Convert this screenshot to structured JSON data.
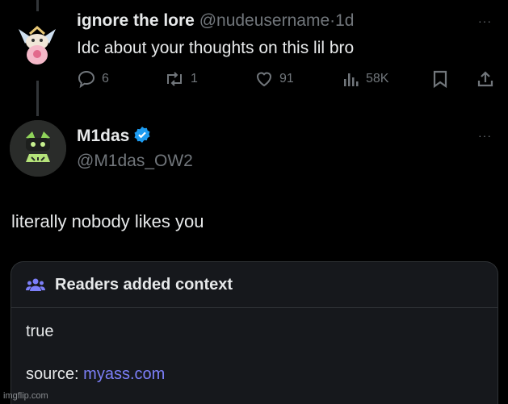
{
  "reply_tweet": {
    "display_name": "ignore the lore",
    "handle": "@nudeusername",
    "separator": "·",
    "time": "1d",
    "text": "Idc about your thoughts on this lil bro",
    "more": "···",
    "actions": {
      "replies": "6",
      "reposts": "1",
      "likes": "91",
      "views": "58K"
    },
    "icons": [
      "reply-icon",
      "repost-icon",
      "like-icon",
      "views-icon",
      "bookmark-icon",
      "share-icon"
    ]
  },
  "main_tweet": {
    "display_name": "M1das",
    "verified": true,
    "handle": "@M1das_OW2",
    "more": "···",
    "text": "literally nobody likes you"
  },
  "community_note": {
    "title": "Readers added context",
    "body": "true",
    "source_label": "source: ",
    "source_link": "myass.com"
  },
  "watermark": "imgflip.com",
  "colors": {
    "background": "#000000",
    "text": "#e7e9ea",
    "muted": "#71767b",
    "verified": "#1d9bf0",
    "note_accent": "#7c7ff8",
    "note_background": "#16181c"
  }
}
